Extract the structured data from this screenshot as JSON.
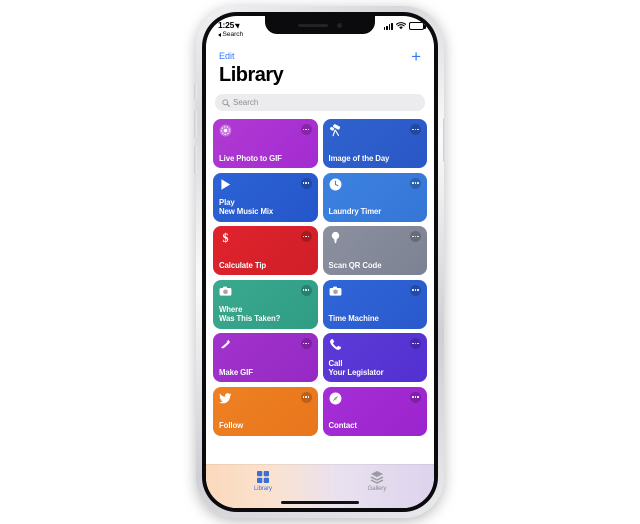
{
  "device": {
    "name": "iPhone X",
    "frame_color": "#e6e6ea",
    "bezel_color": "#0b0b0d"
  },
  "status_bar": {
    "time": "1:25",
    "location_icon": "location-arrow-icon",
    "back_label": "Search",
    "signal_icon": "cellular-signal-icon",
    "wifi_icon": "wifi-icon",
    "battery_icon": "battery-icon",
    "battery_level": 80
  },
  "nav_bar": {
    "edit_label": "Edit",
    "add_label": "+",
    "accent_color": "#3478f6"
  },
  "header": {
    "title": "Library"
  },
  "search": {
    "placeholder": "Search",
    "icon": "search-icon",
    "value": ""
  },
  "shortcuts": [
    {
      "label": "Live Photo to GIF",
      "icon": "live-photo-icon",
      "color_start": "#b13ad2",
      "color_end": "#a32bd1",
      "more_label": "More options"
    },
    {
      "label": "Image of the Day",
      "icon": "telescope-icon",
      "color_start": "#2f63cf",
      "color_end": "#2a57c6",
      "more_label": "More options"
    },
    {
      "label": "Play\nNew Music Mix",
      "icon": "play-icon",
      "color_start": "#2c63d6",
      "color_end": "#2456c9",
      "more_label": "More options"
    },
    {
      "label": "Laundry Timer",
      "icon": "clock-icon",
      "color_start": "#3d82e0",
      "color_end": "#3576d6",
      "more_label": "More options"
    },
    {
      "label": "Calculate Tip",
      "icon": "dollar-icon",
      "color_start": "#e0232d",
      "color_end": "#cf1f28",
      "more_label": "More options"
    },
    {
      "label": "Scan QR Code",
      "icon": "lightbulb-icon",
      "color_start": "#8c909f",
      "color_end": "#7c8293",
      "more_label": "More options"
    },
    {
      "label": "Where\nWas This Taken?",
      "icon": "camera-icon",
      "color_start": "#3aa98e",
      "color_end": "#2f9d84",
      "more_label": "More options"
    },
    {
      "label": "Time Machine",
      "icon": "camera-icon",
      "color_start": "#2f66d8",
      "color_end": "#2a59cc",
      "more_label": "More options"
    },
    {
      "label": "Make GIF",
      "icon": "magic-wand-icon",
      "color_start": "#a233cc",
      "color_end": "#9629c4",
      "more_label": "More options"
    },
    {
      "label": "Call\nYour Legislator",
      "icon": "phone-icon",
      "color_start": "#5b3bd8",
      "color_end": "#5330d0",
      "more_label": "More options"
    },
    {
      "label": "Follow",
      "icon": "twitter-bird-icon",
      "color_start": "#ef8023",
      "color_end": "#e8761c",
      "more_label": "More options"
    },
    {
      "label": "Contact",
      "icon": "compass-icon",
      "color_start": "#a62ed6",
      "color_end": "#9b24cd",
      "more_label": "More options"
    }
  ],
  "tab_bar": {
    "items": [
      {
        "label": "Library",
        "icon": "grid-squares-icon",
        "active": true,
        "active_color": "#3a6fd8"
      },
      {
        "label": "Gallery",
        "icon": "layers-stack-icon",
        "active": false,
        "inactive_color": "#8a8a90"
      }
    ]
  }
}
